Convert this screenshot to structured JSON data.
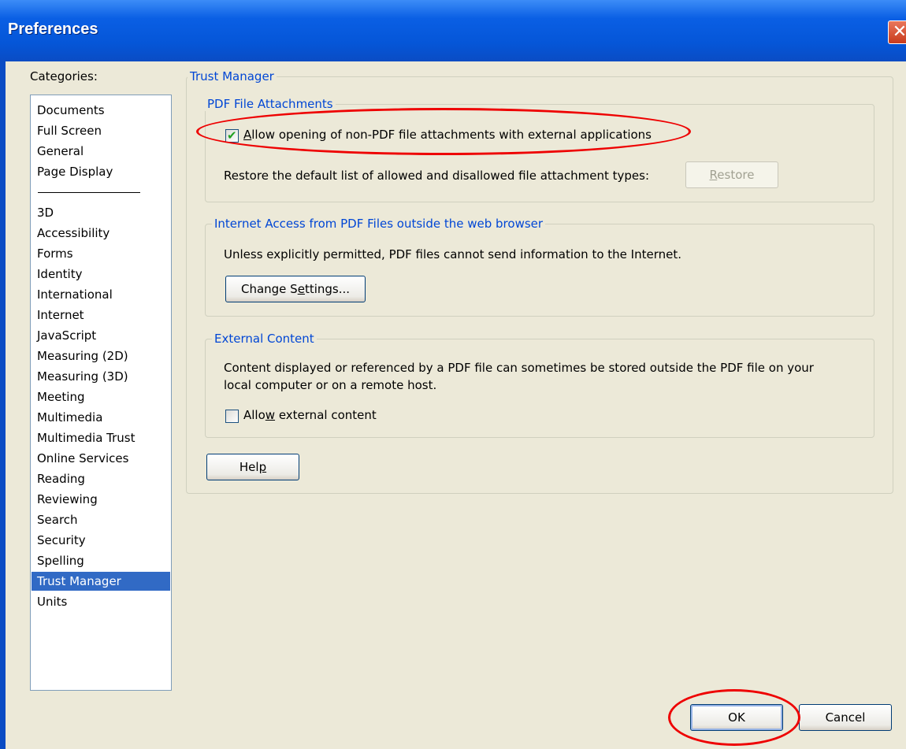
{
  "window": {
    "title": "Preferences",
    "close_label": "✕"
  },
  "categories": {
    "label": "Categories:",
    "items": [
      "Documents",
      "Full Screen",
      "General",
      "Page Display",
      "3D",
      "Accessibility",
      "Forms",
      "Identity",
      "International",
      "Internet",
      "JavaScript",
      "Measuring (2D)",
      "Measuring (3D)",
      "Meeting",
      "Multimedia",
      "Multimedia Trust",
      "Online Services",
      "Reading",
      "Reviewing",
      "Search",
      "Security",
      "Spelling",
      "Trust Manager",
      "Units"
    ],
    "selected": "Trust Manager"
  },
  "trust_manager": {
    "legend": "Trust Manager",
    "pdf_attachments": {
      "legend": "PDF File Attachments",
      "allow_label_prefix": "A",
      "allow_label_rest": "llow opening of non-PDF file attachments with external applications",
      "allow_checked": true,
      "restore_text": "Restore the default list of allowed and disallowed file attachment types:",
      "restore_label_prefix": "R",
      "restore_label_rest": "estore"
    },
    "internet_access": {
      "legend": "Internet Access from PDF Files outside the web browser",
      "text": "Unless explicitly permitted, PDF files cannot send information to the Internet.",
      "change_pre": "Change S",
      "change_accel": "e",
      "change_post": "ttings..."
    },
    "external_content": {
      "legend": "External Content",
      "text_line1": "Content displayed or referenced by a PDF file can sometimes be stored outside the PDF file on your",
      "text_line2": "local computer or on a remote host.",
      "allow_pre": "Allo",
      "allow_accel": "w",
      "allow_post": " external content",
      "allow_checked": false
    },
    "help_pre": "Hel",
    "help_accel": "p"
  },
  "footer": {
    "ok_label": "OK",
    "cancel_label": "Cancel"
  },
  "colors": {
    "title_bar": "#0556d8",
    "selection": "#316ac5",
    "legend_text": "#0046d5",
    "annotation_ellipse": "#e00000"
  }
}
